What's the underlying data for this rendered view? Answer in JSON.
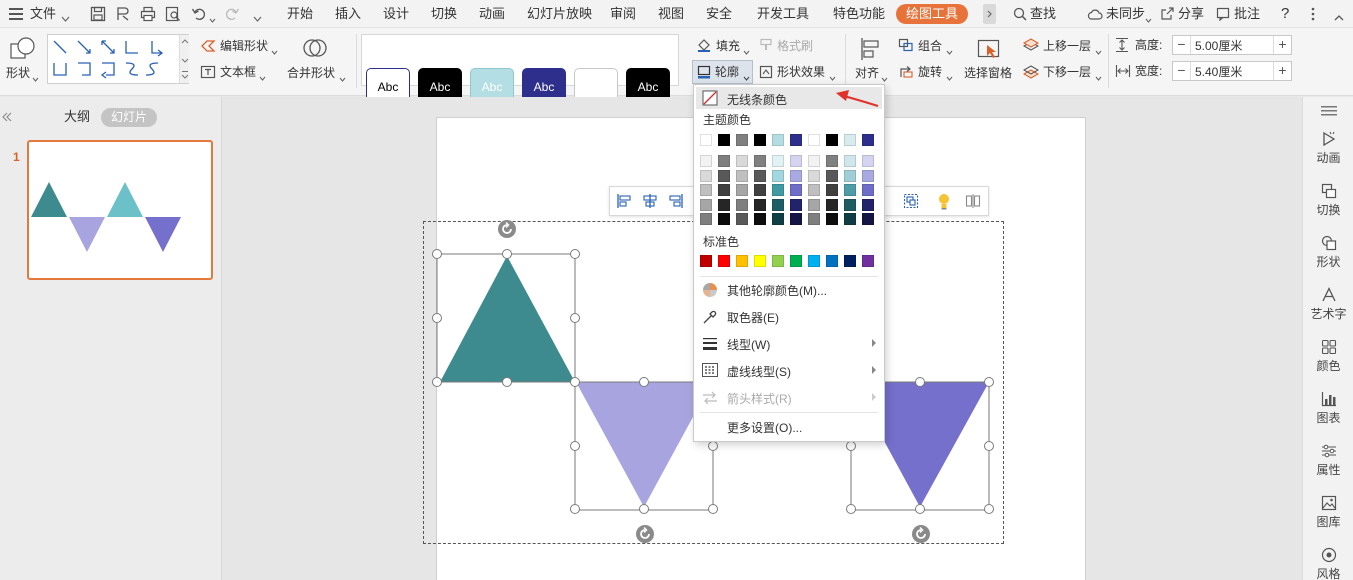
{
  "menubar": {
    "file_label": "文件",
    "tabs": [
      "开始",
      "插入",
      "设计",
      "切换",
      "动画",
      "幻灯片放映",
      "审阅",
      "视图",
      "安全",
      "开发工具",
      "特色功能"
    ],
    "active_tab": "绘图工具",
    "search_label": "查找",
    "sync_label": "未同步",
    "share_label": "分享",
    "comment_label": "批注",
    "help_label": "?"
  },
  "ribbon": {
    "shape_label": "形状",
    "edit_shape_label": "编辑形状",
    "textbox_label": "文本框",
    "merge_shape_label": "合并形状",
    "style_swatches": [
      {
        "label": "Abc",
        "bg": "#ffffff",
        "fg": "#000000",
        "border": "#2e2f8c"
      },
      {
        "label": "Abc",
        "bg": "#000000",
        "fg": "#ffffff",
        "border": "#000000"
      },
      {
        "label": "Abc",
        "bg": "#b3dfe4",
        "fg": "#ffffff",
        "border": "#8fc8cf"
      },
      {
        "label": "Abc",
        "bg": "#2e2f8c",
        "fg": "#ffffff",
        "border": "#2e2f8c"
      },
      {
        "label": "",
        "bg": "#ffffff",
        "fg": "#000000",
        "border": "#c8c8c8"
      },
      {
        "label": "Abc",
        "bg": "#000000",
        "fg": "#ffffff",
        "border": "#000000"
      }
    ],
    "fill_label": "填充",
    "format_brush_label": "格式刷",
    "outline_label": "轮廓",
    "shape_effect_label": "形状效果",
    "align_label": "对齐",
    "group_label": "组合",
    "rotate_label": "旋转",
    "select_pane_label": "选择窗格",
    "bring_forward_label": "上移一层",
    "send_backward_label": "下移一层",
    "height_label": "高度:",
    "height_value": "5.00厘米",
    "width_label": "宽度:",
    "width_value": "5.40厘米"
  },
  "leftpanel": {
    "outline_tab": "大纲",
    "slides_tab": "幻灯片",
    "slide_number": "1"
  },
  "rightbar": {
    "items": [
      "动画",
      "切换",
      "形状",
      "艺术字",
      "颜色",
      "图表",
      "属性",
      "图库",
      "风格"
    ]
  },
  "dropdown": {
    "no_outline_label": "无线条颜色",
    "theme_colors_label": "主题颜色",
    "theme_top_row": [
      "#ffffff",
      "#000000",
      "#7f7f7f",
      "#000000",
      "#b4dde3",
      "#2e2f8c",
      "#ffffff",
      "#000000",
      "#d8ecf0",
      "#2e2f8c"
    ],
    "theme_shade_columns": [
      [
        "#f2f2f2",
        "#d9d9d9",
        "#bfbfbf",
        "#a6a6a6",
        "#7f7f7f"
      ],
      [
        "#7f7f7f",
        "#595959",
        "#404040",
        "#262626",
        "#0d0d0d"
      ],
      [
        "#d9d9d9",
        "#bfbfbf",
        "#a6a6a6",
        "#7f7f7f",
        "#595959"
      ],
      [
        "#7f7f7f",
        "#595959",
        "#404040",
        "#262626",
        "#0d0d0d"
      ],
      [
        "#e1f2f5",
        "#a3d6dd",
        "#3f9aa3",
        "#1d5e66",
        "#0e3f45"
      ],
      [
        "#d4d4f0",
        "#a9a9e2",
        "#6e6ec9",
        "#22236b",
        "#151646"
      ],
      [
        "#f2f2f2",
        "#d9d9d9",
        "#bfbfbf",
        "#a6a6a6",
        "#7f7f7f"
      ],
      [
        "#7f7f7f",
        "#595959",
        "#404040",
        "#262626",
        "#0d0d0d"
      ],
      [
        "#cfe6ea",
        "#9fced6",
        "#4d9ca6",
        "#1e5c64",
        "#0f3d42"
      ],
      [
        "#d4d4f0",
        "#a9a9e2",
        "#6e6ec9",
        "#22236b",
        "#151646"
      ]
    ],
    "standard_colors_label": "标准色",
    "standard_colors": [
      "#c00000",
      "#ff0000",
      "#ffc000",
      "#ffff00",
      "#92d050",
      "#00b050",
      "#00b0f0",
      "#0070c0",
      "#002060",
      "#7030a0"
    ],
    "more_colors_label": "其他轮廓颜色(M)...",
    "eyedropper_label": "取色器(E)",
    "line_type_label": "线型(W)",
    "dash_type_label": "虚线线型(S)",
    "arrow_style_label": "箭头样式(R)",
    "more_settings_label": "更多设置(O)..."
  },
  "shapes": {
    "teal": "#3d8b8f",
    "light_purple": "#a8a4e0",
    "purple": "#7470cc",
    "thumb_teal": "#3e8b8f",
    "thumb_light_teal": "#6cc0c7",
    "thumb_light_purple": "#a8a4e0",
    "thumb_purple": "#7470cc"
  }
}
